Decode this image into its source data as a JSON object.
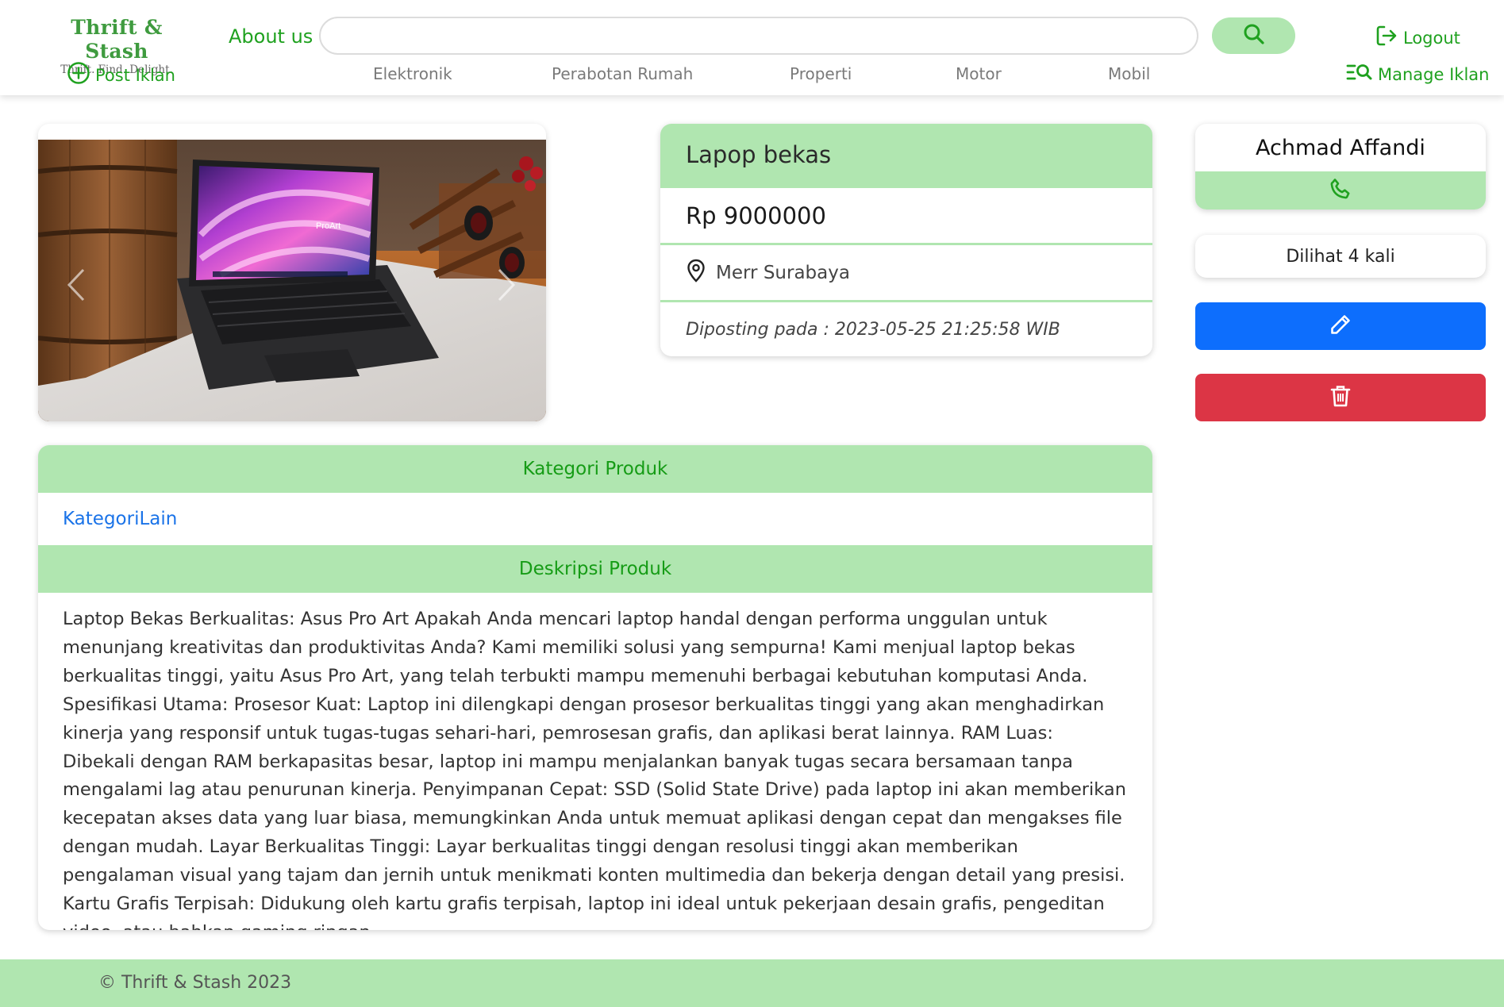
{
  "header": {
    "brand_title": "Thrift & Stash",
    "brand_tagline": "Thrift. Find. Delight.",
    "post_label": "Post Iklan",
    "about_label": "About us",
    "search_value": "",
    "categories": [
      "Elektronik",
      "Perabotan Rumah",
      "Properti",
      "Motor",
      "Mobil"
    ],
    "logout_label": "Logout",
    "manage_label": "Manage Iklan"
  },
  "product": {
    "title": "Lapop bekas",
    "price": "Rp 9000000",
    "location": "Merr Surabaya",
    "posted": "Diposting pada : 2023-05-25 21:25:58 WIB"
  },
  "seller": {
    "name": "Achmad Affandi",
    "views": "Dilihat 4 kali"
  },
  "details": {
    "category_heading": "Kategori Produk",
    "category": "KategoriLain",
    "description_heading": "Deskripsi Produk",
    "description": "Laptop Bekas Berkualitas: Asus Pro Art Apakah Anda mencari laptop handal dengan performa unggulan untuk menunjang kreativitas dan produktivitas Anda? Kami memiliki solusi yang sempurna! Kami menjual laptop bekas berkualitas tinggi, yaitu Asus Pro Art, yang telah terbukti mampu memenuhi berbagai kebutuhan komputasi Anda. Spesifikasi Utama: Prosesor Kuat: Laptop ini dilengkapi dengan prosesor berkualitas tinggi yang akan menghadirkan kinerja yang responsif untuk tugas-tugas sehari-hari, pemrosesan grafis, dan aplikasi berat lainnya. RAM Luas: Dibekali dengan RAM berkapasitas besar, laptop ini mampu menjalankan banyak tugas secara bersamaan tanpa mengalami lag atau penurunan kinerja. Penyimpanan Cepat: SSD (Solid State Drive) pada laptop ini akan memberikan kecepatan akses data yang luar biasa, memungkinkan Anda untuk memuat aplikasi dengan cepat dan mengakses file dengan mudah. Layar Berkualitas Tinggi: Layar berkualitas tinggi dengan resolusi tinggi akan memberikan pengalaman visual yang tajam dan jernih untuk menikmati konten multimedia dan bekerja dengan detail yang presisi. Kartu Grafis Terpisah: Didukung oleh kartu grafis terpisah, laptop ini ideal untuk pekerjaan desain grafis, pengeditan video, atau bahkan gaming ringan."
  },
  "photo": {
    "screen_text": "ProArt"
  },
  "footer": {
    "text": "© Thrift & Stash 2023"
  },
  "colors": {
    "brand_green": "#3f9b3f",
    "accent_green": "#1fa11f",
    "panel_green": "#b0e6b0",
    "edit_blue": "#0d6efd",
    "delete_red": "#dc3545",
    "link_blue": "#1a73e8"
  },
  "icons": {
    "post": "plus-circle-icon",
    "search": "search-icon",
    "logout": "logout-icon",
    "manage": "list-search-icon",
    "location": "map-pin-icon",
    "phone": "phone-icon",
    "edit": "pencil-icon",
    "delete": "trash-icon",
    "prev": "chevron-left-icon",
    "next": "chevron-right-icon"
  }
}
